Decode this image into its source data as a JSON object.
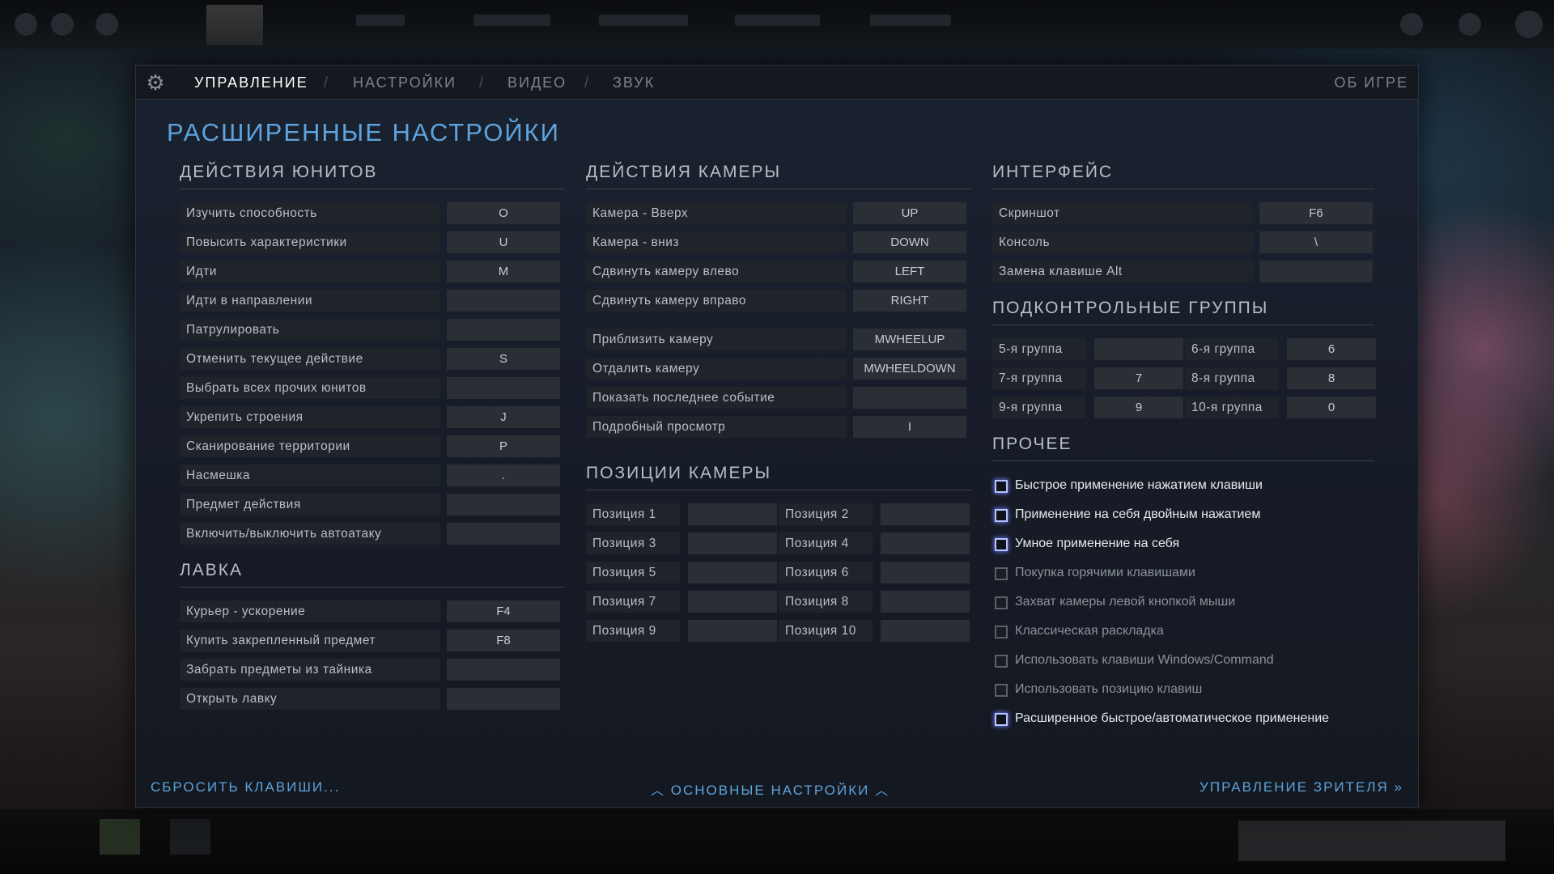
{
  "nav": {
    "tabs": [
      "УПРАВЛЕНИЕ",
      "НАСТРОЙКИ",
      "ВИДЕО",
      "ЗВУК"
    ],
    "sep": "/",
    "about": "ОБ ИГРЕ"
  },
  "title": "РАСШИРЕННЫЕ НАСТРОЙКИ",
  "sections": {
    "units": "ДЕЙСТВИЯ ЮНИТОВ",
    "shop": "ЛАВКА",
    "camera": "ДЕЙСТВИЯ КАМЕРЫ",
    "cam_positions": "ПОЗИЦИИ КАМЕРЫ",
    "interface": "ИНТЕРФЕЙС",
    "groups": "ПОДКОНТРОЛЬНЫЕ ГРУППЫ",
    "other": "ПРОЧЕЕ"
  },
  "units": [
    {
      "label": "Изучить способность",
      "key": "O"
    },
    {
      "label": "Повысить характеристики",
      "key": "U"
    },
    {
      "label": "Идти",
      "key": "M"
    },
    {
      "label": "Идти в направлении",
      "key": ""
    },
    {
      "label": "Патрулировать",
      "key": ""
    },
    {
      "label": "Отменить текущее действие",
      "key": "S"
    },
    {
      "label": "Выбрать всех прочих юнитов",
      "key": ""
    },
    {
      "label": "Укрепить строения",
      "key": "J"
    },
    {
      "label": "Сканирование территории",
      "key": "P"
    },
    {
      "label": "Насмешка",
      "key": "."
    },
    {
      "label": "Предмет действия",
      "key": ""
    },
    {
      "label": "Включить/выключить автоатаку",
      "key": ""
    }
  ],
  "shop": [
    {
      "label": "Курьер - ускорение",
      "key": "F4"
    },
    {
      "label": "Купить закрепленный предмет",
      "key": "F8"
    },
    {
      "label": "Забрать предметы из тайника",
      "key": ""
    },
    {
      "label": "Открыть лавку",
      "key": ""
    }
  ],
  "camera": [
    {
      "label": "Камера - Вверх",
      "key": "UP"
    },
    {
      "label": "Камера - вниз",
      "key": "DOWN"
    },
    {
      "label": "Сдвинуть камеру влево",
      "key": "LEFT"
    },
    {
      "label": "Сдвинуть камеру вправо",
      "key": "RIGHT"
    }
  ],
  "camera_zoom": [
    {
      "label": "Приблизить камеру",
      "key": "MWHEELUP"
    },
    {
      "label": "Отдалить камеру",
      "key": "MWHEELDOWN"
    }
  ],
  "camera_misc": [
    {
      "label": "Показать последнее событие",
      "key": ""
    },
    {
      "label": "Подробный просмотр",
      "key": "I"
    }
  ],
  "cam_positions": [
    {
      "label": "Позиция 1",
      "key": ""
    },
    {
      "label": "Позиция 2",
      "key": ""
    },
    {
      "label": "Позиция 3",
      "key": ""
    },
    {
      "label": "Позиция 4",
      "key": ""
    },
    {
      "label": "Позиция 5",
      "key": ""
    },
    {
      "label": "Позиция 6",
      "key": ""
    },
    {
      "label": "Позиция 7",
      "key": ""
    },
    {
      "label": "Позиция 8",
      "key": ""
    },
    {
      "label": "Позиция 9",
      "key": ""
    },
    {
      "label": "Позиция 10",
      "key": ""
    }
  ],
  "interface": [
    {
      "label": "Скриншот",
      "key": "F6"
    },
    {
      "label": "Консоль",
      "key": "\\"
    },
    {
      "label": "Замена клавише Alt",
      "key": ""
    }
  ],
  "groups": [
    {
      "label": "5-я группа",
      "key": ""
    },
    {
      "label": "6-я группа",
      "key": "6"
    },
    {
      "label": "7-я группа",
      "key": "7"
    },
    {
      "label": "8-я группа",
      "key": "8"
    },
    {
      "label": "9-я группа",
      "key": "9"
    },
    {
      "label": "10-я группа",
      "key": "0"
    }
  ],
  "other": [
    {
      "label": "Быстрое применение нажатием клавиши",
      "checked": true
    },
    {
      "label": "Применение на себя двойным нажатием",
      "checked": true
    },
    {
      "label": "Умное применение на себя",
      "checked": true
    },
    {
      "label": "Покупка горячими клавишами",
      "checked": false
    },
    {
      "label": "Захват камеры левой кнопкой мыши",
      "checked": false
    },
    {
      "label": "Классическая раскладка",
      "checked": false
    },
    {
      "label": "Использовать клавиши Windows/Command",
      "checked": false
    },
    {
      "label": "Использовать позицию клавиш",
      "checked": false
    },
    {
      "label": "Расширенное быстрое/автоматическое применение",
      "checked": true
    }
  ],
  "footer": {
    "reset": "СБРОСИТЬ КЛАВИШИ...",
    "main": "ОСНОВНЫЕ НАСТРОЙКИ",
    "spectator": "УПРАВЛЕНИЕ ЗРИТЕЛЯ"
  },
  "icons": {
    "gear": "gear-icon",
    "chevron_up": "chevron-up-icon",
    "double_chevron": "double-chevron-right-icon"
  }
}
